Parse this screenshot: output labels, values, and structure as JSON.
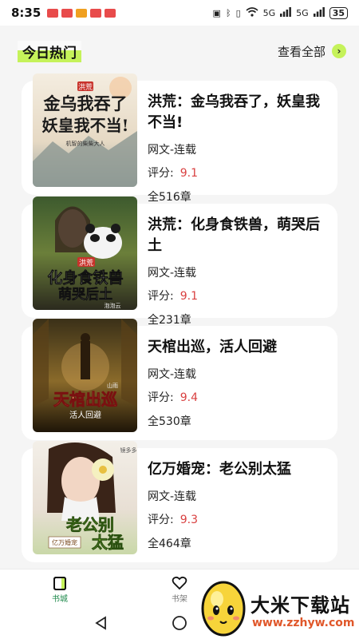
{
  "status_bar": {
    "time": "8:35",
    "battery": "35",
    "network": "5G",
    "notification_colors": [
      "#e84b4b",
      "#e84b4b",
      "#f0a020",
      "#e84b4b",
      "#e84b4b"
    ]
  },
  "section": {
    "title": "今日热门",
    "view_all": "查看全部",
    "accent_color": "#c5f25a"
  },
  "books": [
    {
      "title": "洪荒：金乌我吞了，妖皇我不当!",
      "category": "网文-连载",
      "rating_label": "评分:",
      "rating": "9.1",
      "chapters": "全516章",
      "cover": {
        "lines": [
          "金乌我吞了",
          "妖皇我不当!"
        ],
        "tag": "洪荒",
        "author": "机智的柴柴大人"
      }
    },
    {
      "title": "洪荒：化身食铁兽，萌哭后土",
      "category": "网文-连载",
      "rating_label": "评分:",
      "rating": "9.1",
      "chapters": "全231章",
      "cover": {
        "lines": [
          "化身食铁兽",
          "萌哭后土"
        ],
        "tag": "洪荒",
        "author": "泡泡云"
      }
    },
    {
      "title": "天棺出巡，活人回避",
      "category": "网文-连载",
      "rating_label": "评分:",
      "rating": "9.4",
      "chapters": "全530章",
      "cover": {
        "lines": [
          "天棺出巡",
          "活人回避"
        ],
        "tag": "",
        "author": "山雨"
      }
    },
    {
      "title": "亿万婚宠：老公别太猛",
      "category": "网文-连载",
      "rating_label": "评分:",
      "rating": "9.3",
      "chapters": "全464章",
      "cover": {
        "lines": [
          "老公别",
          "太猛"
        ],
        "tag": "亿万婚宠",
        "author": "镜多多"
      }
    }
  ],
  "bottom_nav": {
    "items": [
      {
        "label": "书城",
        "icon": "book-icon",
        "active": true
      },
      {
        "label": "书架",
        "icon": "heart-icon",
        "active": false
      }
    ],
    "active_color": "#1f8a4c"
  },
  "watermark": {
    "title": "大米下载站",
    "url": "www.zzhyw.com"
  }
}
